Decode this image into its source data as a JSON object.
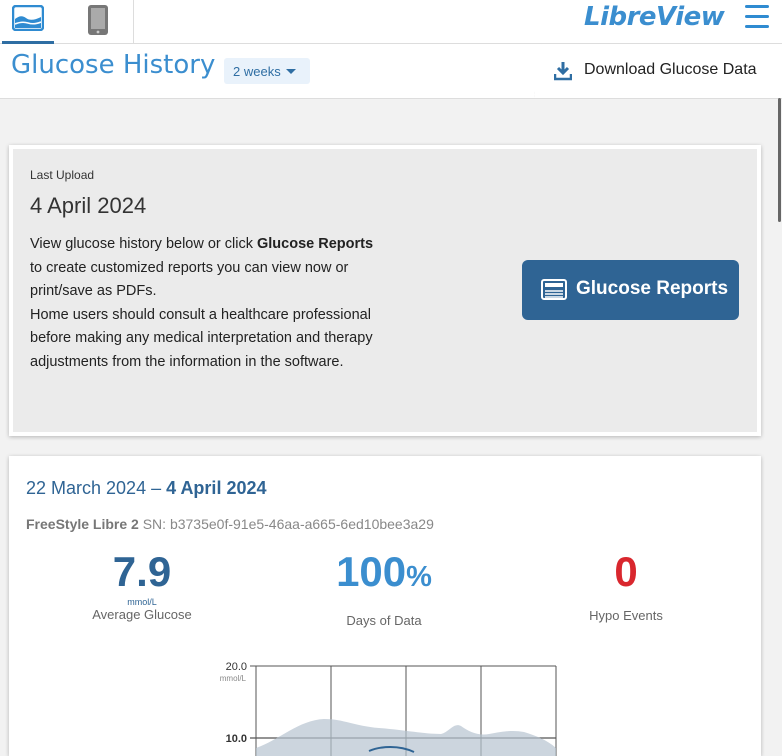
{
  "header": {
    "brand": "LibreView",
    "nav": [
      {
        "icon": "glucose-chart-icon",
        "active": true
      },
      {
        "icon": "tablet-icon",
        "active": false
      }
    ],
    "menu_icon": "hamburger-menu-icon"
  },
  "subheader": {
    "title": "Glucose History",
    "period": "2 weeks",
    "download_label": "Download Glucose Data"
  },
  "upload": {
    "label": "Last Upload",
    "date": "4 April 2024",
    "text_before": "View glucose history below or click ",
    "text_bold": "Glucose Reports",
    "text_after": " to create customized reports you can view now or print/save as PDFs.",
    "text_2": "Home users should consult a healthcare professional before making any medical interpretation and therapy adjustments from the information in the software.",
    "reports_button": "Glucose Reports"
  },
  "summary": {
    "range_start": "22 March 2024",
    "range_sep": " – ",
    "range_end": "4 April 2024",
    "device_name": "FreeStyle Libre 2",
    "serial": "SN: b3735e0f-91e5-46aa-a665-6ed10bee3a29",
    "stats": [
      {
        "value": "7.9",
        "unit": "",
        "sub_unit": "mmol/L",
        "label": "Average Glucose",
        "color": "#2f6494"
      },
      {
        "value": "100",
        "unit": "%",
        "sub_unit": "",
        "label": "Days of Data",
        "color": "#3b8ecf"
      },
      {
        "value": "0",
        "unit": "",
        "sub_unit": "",
        "label": "Hypo Events",
        "color": "#d9272e"
      }
    ]
  },
  "chart_data": {
    "type": "area",
    "y_ticks": [
      "20.0",
      "10.0"
    ],
    "y_unit": "mmol/L",
    "ylim": [
      0,
      20
    ],
    "grid": true
  },
  "colors": {
    "brand": "#3b8ecf",
    "dark_blue": "#2f6494",
    "hypo_red": "#d9272e"
  }
}
